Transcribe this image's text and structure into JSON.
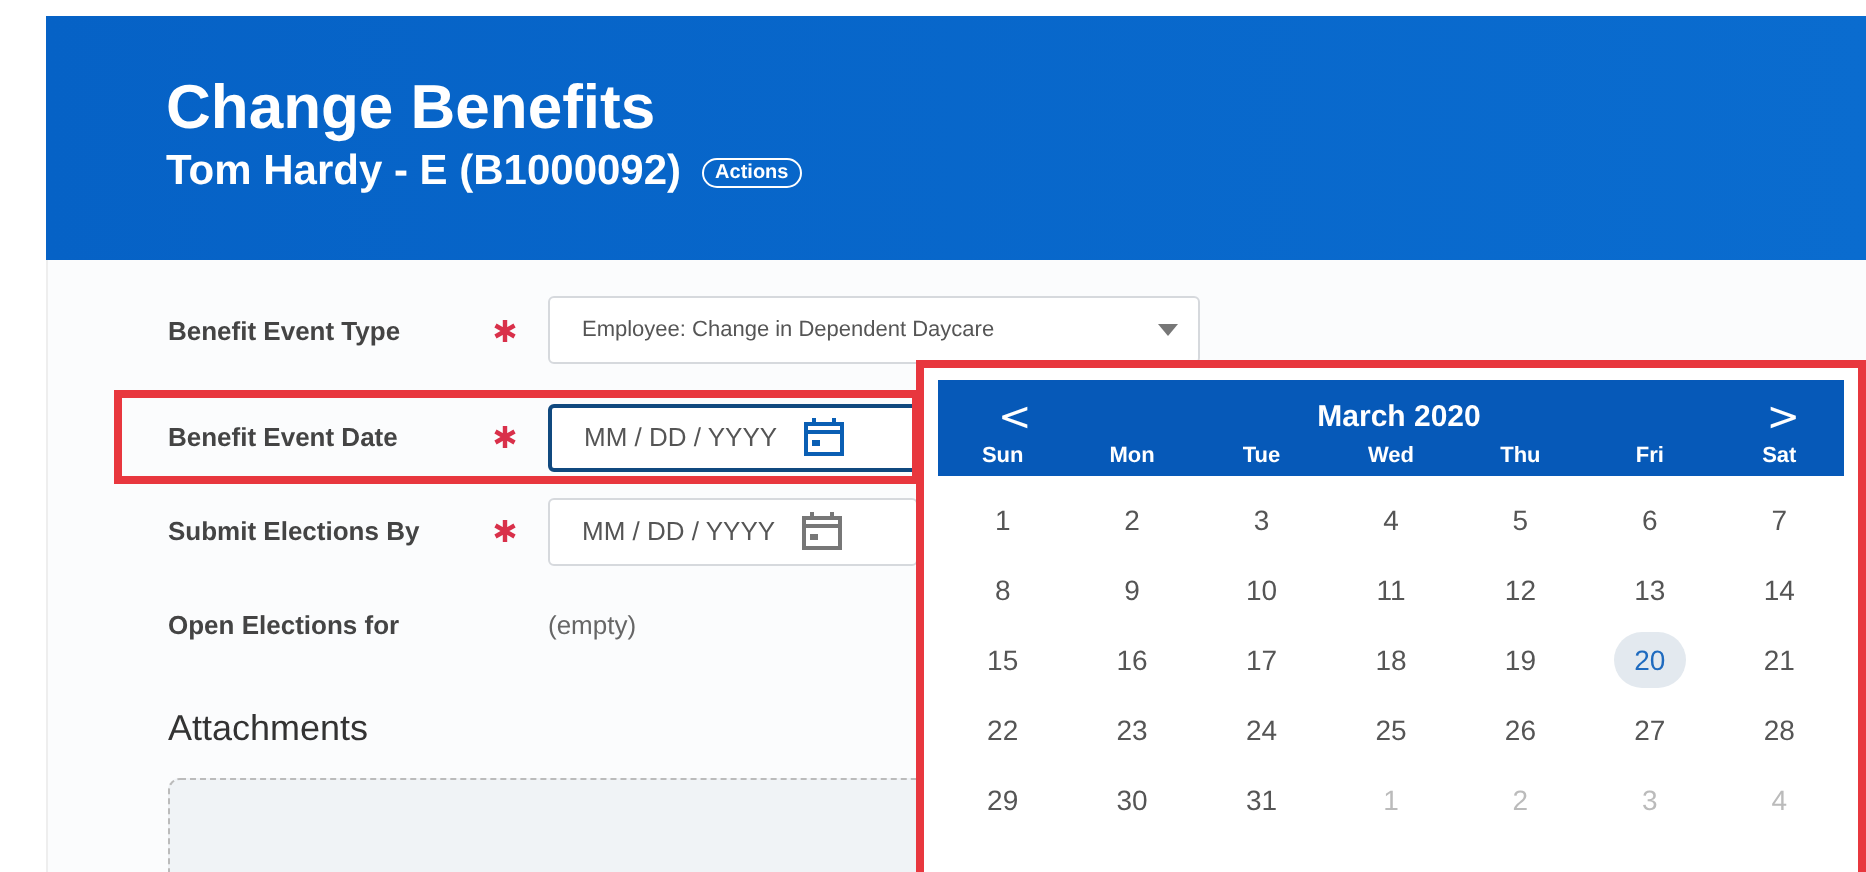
{
  "header": {
    "title": "Change Benefits",
    "subtitle": "Tom Hardy - E (B1000092)",
    "actions_button": "Actions"
  },
  "fields": [
    {
      "label": "Benefit Event Type",
      "required": true,
      "kind": "select",
      "value": "Employee: Change in Dependent Daycare"
    },
    {
      "label": "Benefit Event Date",
      "required": true,
      "kind": "date",
      "placeholder": "MM / DD / YYYY",
      "highlighted": true,
      "focused": true
    },
    {
      "label": "Submit Elections By",
      "required": true,
      "kind": "date",
      "placeholder": "MM / DD / YYYY"
    },
    {
      "label": "Open Elections for",
      "required": false,
      "kind": "text",
      "value": "(empty)"
    }
  ],
  "attachments": {
    "title": "Attachments"
  },
  "calendar": {
    "highlighted": true,
    "prev": "<",
    "month": "March 2020",
    "next": ">",
    "weekdays": [
      "Sun",
      "Mon",
      "Tue",
      "Wed",
      "Thu",
      "Fri",
      "Sat"
    ],
    "days": [
      {
        "label": "1",
        "in_month": true,
        "selected": false
      },
      {
        "label": "2",
        "in_month": true,
        "selected": false
      },
      {
        "label": "3",
        "in_month": true,
        "selected": false
      },
      {
        "label": "4",
        "in_month": true,
        "selected": false
      },
      {
        "label": "5",
        "in_month": true,
        "selected": false
      },
      {
        "label": "6",
        "in_month": true,
        "selected": false
      },
      {
        "label": "7",
        "in_month": true,
        "selected": false
      },
      {
        "label": "8",
        "in_month": true,
        "selected": false
      },
      {
        "label": "9",
        "in_month": true,
        "selected": false
      },
      {
        "label": "10",
        "in_month": true,
        "selected": false
      },
      {
        "label": "11",
        "in_month": true,
        "selected": false
      },
      {
        "label": "12",
        "in_month": true,
        "selected": false
      },
      {
        "label": "13",
        "in_month": true,
        "selected": false
      },
      {
        "label": "14",
        "in_month": true,
        "selected": false
      },
      {
        "label": "15",
        "in_month": true,
        "selected": false
      },
      {
        "label": "16",
        "in_month": true,
        "selected": false
      },
      {
        "label": "17",
        "in_month": true,
        "selected": false
      },
      {
        "label": "18",
        "in_month": true,
        "selected": false
      },
      {
        "label": "19",
        "in_month": true,
        "selected": false
      },
      {
        "label": "20",
        "in_month": true,
        "selected": true
      },
      {
        "label": "21",
        "in_month": true,
        "selected": false
      },
      {
        "label": "22",
        "in_month": true,
        "selected": false
      },
      {
        "label": "23",
        "in_month": true,
        "selected": false
      },
      {
        "label": "24",
        "in_month": true,
        "selected": false
      },
      {
        "label": "25",
        "in_month": true,
        "selected": false
      },
      {
        "label": "26",
        "in_month": true,
        "selected": false
      },
      {
        "label": "27",
        "in_month": true,
        "selected": false
      },
      {
        "label": "28",
        "in_month": true,
        "selected": false
      },
      {
        "label": "29",
        "in_month": true,
        "selected": false
      },
      {
        "label": "30",
        "in_month": true,
        "selected": false
      },
      {
        "label": "31",
        "in_month": true,
        "selected": false
      },
      {
        "label": "1",
        "in_month": false,
        "selected": false
      },
      {
        "label": "2",
        "in_month": false,
        "selected": false
      },
      {
        "label": "3",
        "in_month": false,
        "selected": false
      },
      {
        "label": "4",
        "in_month": false,
        "selected": false
      }
    ]
  }
}
